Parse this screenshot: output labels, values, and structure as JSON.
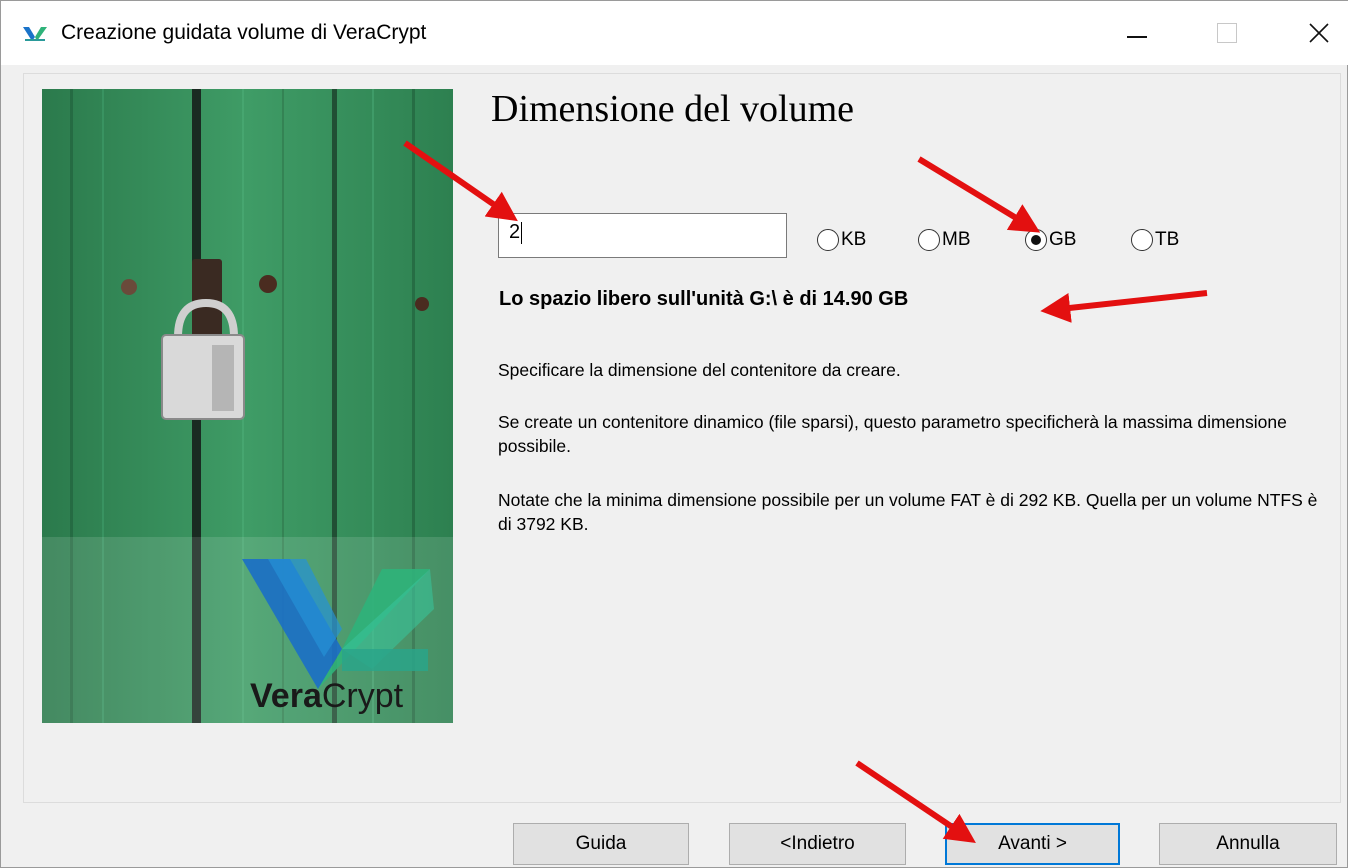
{
  "window": {
    "title": "Creazione guidata volume di VeraCrypt"
  },
  "page": {
    "heading": "Dimensione del volume",
    "size_value": "2",
    "units": [
      {
        "label": "KB",
        "checked": false
      },
      {
        "label": "MB",
        "checked": false
      },
      {
        "label": "GB",
        "checked": true
      },
      {
        "label": "TB",
        "checked": false
      }
    ],
    "free_space": "Lo spazio libero sull'unità G:\\ è di 14.90 GB",
    "info_1": "Specificare la dimensione del contenitore da creare.",
    "info_2": "Se create un contenitore dinamico (file sparsi), questo parametro specificherà la massima dimensione possibile.",
    "info_3": "Notate che la minima dimensione possibile per un volume FAT è di 292 KB. Quella per un volume NTFS è di 3792 KB."
  },
  "logo": {
    "bold": "Vera",
    "regular": "Crypt"
  },
  "buttons": {
    "help": "Guida",
    "back": "<Indietro",
    "next": "Avanti >",
    "cancel": "Annulla"
  },
  "colors": {
    "annotation_arrow": "#e31010",
    "focus_border": "#0078d7",
    "art_green": "#2f8a55"
  },
  "icons": {
    "app": "veracrypt-logo-icon",
    "minimize": "minimize-icon",
    "maximize": "maximize-icon",
    "close": "close-icon"
  }
}
